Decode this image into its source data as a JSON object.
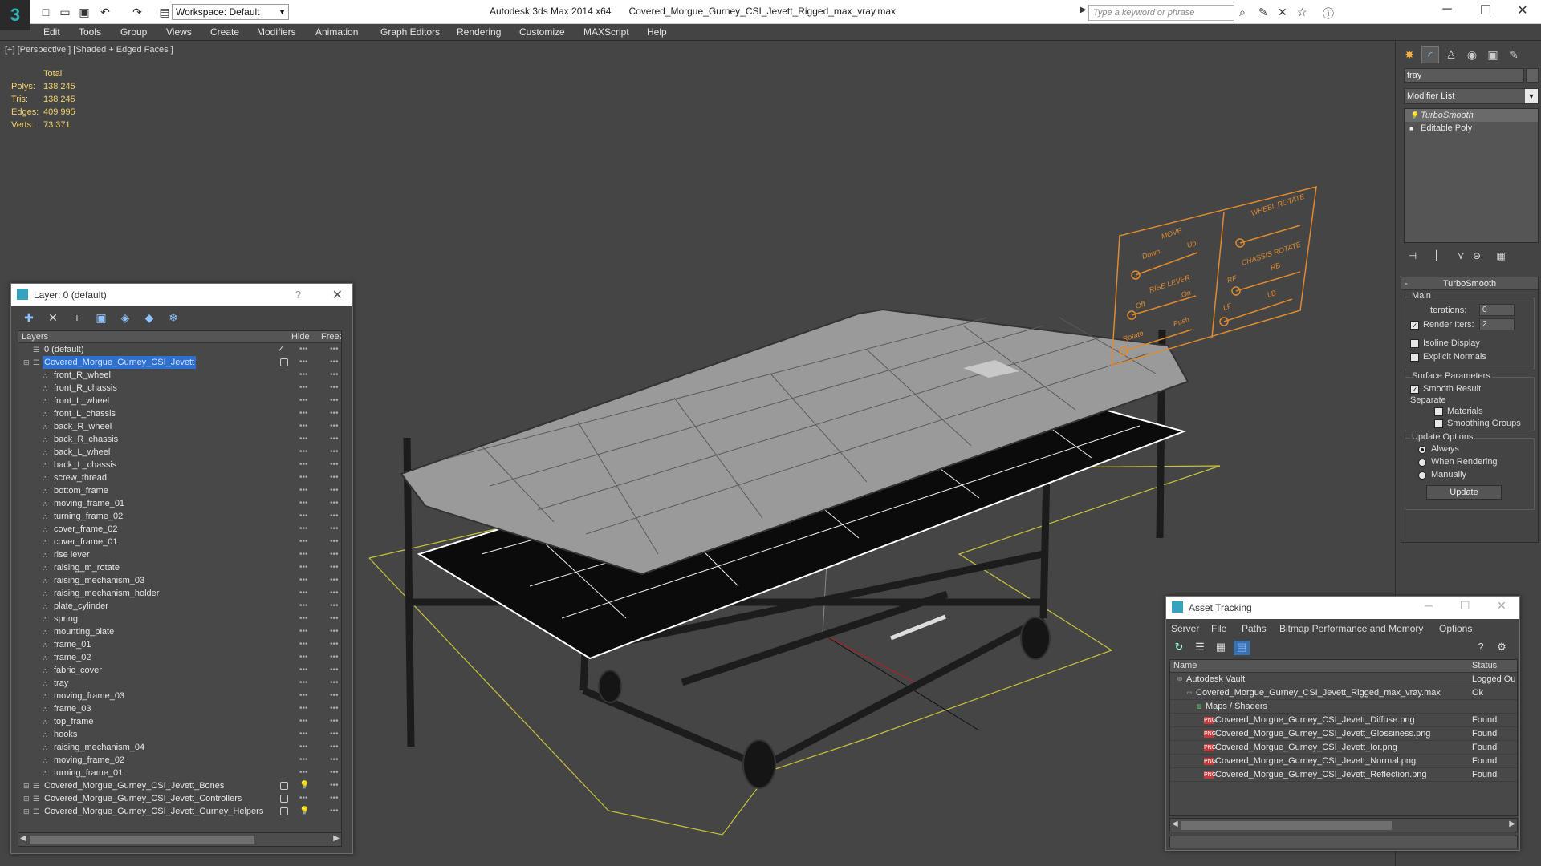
{
  "titlebar": {
    "workspace": "Workspace: Default",
    "app_name": "Autodesk 3ds Max  2014 x64",
    "file_name": "Covered_Morgue_Gurney_CSI_Jevett_Rigged_max_vray.max",
    "search_placeholder": "Type a keyword or phrase"
  },
  "menu": [
    "Edit",
    "Tools",
    "Group",
    "Views",
    "Create",
    "Modifiers",
    "Animation",
    "Graph Editors",
    "Rendering",
    "Customize",
    "MAXScript",
    "Help"
  ],
  "viewport": {
    "label": "[+] [Perspective ] [Shaded + Edged Faces ]",
    "stats": {
      "header": "Total",
      "rows": [
        {
          "label": "Polys:",
          "value": "138 245"
        },
        {
          "label": "Tris:",
          "value": "138 245"
        },
        {
          "label": "Edges:",
          "value": "409 995"
        },
        {
          "label": "Verts:",
          "value": "73 371"
        }
      ]
    },
    "panel_labels": {
      "move": "MOVE",
      "down": "Down",
      "up": "Up",
      "rise_lever": "RISE LEVER",
      "off": "Off",
      "on": "On",
      "rotate": "Rotate",
      "push": "Push",
      "wheel_rotate": "WHEEL ROTATE",
      "chassis_rotate": "CHASSIS ROTATE",
      "rf": "RF",
      "rb": "RB",
      "lf": "LF",
      "lb": "LB"
    }
  },
  "command_panel": {
    "object_name": "tray",
    "modifier_list": "Modifier List",
    "stack": [
      "TurboSmooth",
      "Editable Poly"
    ],
    "rollout": {
      "title": "TurboSmooth",
      "main_label": "Main",
      "iterations_label": "Iterations:",
      "iterations_value": "0",
      "render_iters_label": "Render Iters:",
      "render_iters_value": "2",
      "isoline": "Isoline Display",
      "explicit": "Explicit Normals",
      "surface_label": "Surface Parameters",
      "smooth_result": "Smooth Result",
      "separate": "Separate",
      "materials": "Materials",
      "smoothing_groups": "Smoothing Groups",
      "update_options": "Update Options",
      "always": "Always",
      "when_rendering": "When Rendering",
      "manually": "Manually",
      "update_button": "Update"
    }
  },
  "layer_window": {
    "title": "Layer: 0 (default)",
    "help": "?",
    "col_layers": "Layers",
    "col_hide": "Hide",
    "col_freeze": "Freez",
    "rows": [
      {
        "name": "0 (default)",
        "level": 0
      },
      {
        "name": "Covered_Morgue_Gurney_CSI_Jevett",
        "level": 0
      },
      {
        "name": "front_R_wheel",
        "level": 1
      },
      {
        "name": "front_R_chassis",
        "level": 1
      },
      {
        "name": "front_L_wheel",
        "level": 1
      },
      {
        "name": "front_L_chassis",
        "level": 1
      },
      {
        "name": "back_R_wheel",
        "level": 1
      },
      {
        "name": "back_R_chassis",
        "level": 1
      },
      {
        "name": "back_L_wheel",
        "level": 1
      },
      {
        "name": "back_L_chassis",
        "level": 1
      },
      {
        "name": "screw_thread",
        "level": 1
      },
      {
        "name": "bottom_frame",
        "level": 1
      },
      {
        "name": "moving_frame_01",
        "level": 1
      },
      {
        "name": "turning_frame_02",
        "level": 1
      },
      {
        "name": "cover_frame_02",
        "level": 1
      },
      {
        "name": "cover_frame_01",
        "level": 1
      },
      {
        "name": "rise lever",
        "level": 1
      },
      {
        "name": "raising_m_rotate",
        "level": 1
      },
      {
        "name": "raising_mechanism_03",
        "level": 1
      },
      {
        "name": "raising_mechanism_holder",
        "level": 1
      },
      {
        "name": "plate_cylinder",
        "level": 1
      },
      {
        "name": "spring",
        "level": 1
      },
      {
        "name": "mounting_plate",
        "level": 1
      },
      {
        "name": "frame_01",
        "level": 1
      },
      {
        "name": "frame_02",
        "level": 1
      },
      {
        "name": "fabric_cover",
        "level": 1
      },
      {
        "name": "tray",
        "level": 1
      },
      {
        "name": "moving_frame_03",
        "level": 1
      },
      {
        "name": "frame_03",
        "level": 1
      },
      {
        "name": "top_frame",
        "level": 1
      },
      {
        "name": "hooks",
        "level": 1
      },
      {
        "name": "raising_mechanism_04",
        "level": 1
      },
      {
        "name": "moving_frame_02",
        "level": 1
      },
      {
        "name": "turning_frame_01",
        "level": 1
      },
      {
        "name": "Covered_Morgue_Gurney_CSI_Jevett_Bones",
        "level": 0
      },
      {
        "name": "Covered_Morgue_Gurney_CSI_Jevett_Controllers",
        "level": 0
      },
      {
        "name": "Covered_Morgue_Gurney_CSI_Jevett_Gurney_Helpers",
        "level": 0
      }
    ]
  },
  "asset_window": {
    "title": "Asset Tracking",
    "menu": [
      "Server",
      "File",
      "Paths",
      "Bitmap Performance and Memory",
      "Options"
    ],
    "col_name": "Name",
    "col_status": "Status",
    "rows": [
      {
        "name": "Autodesk Vault",
        "status": "Logged Ou",
        "indent": 0
      },
      {
        "name": "Covered_Morgue_Gurney_CSI_Jevett_Rigged_max_vray.max",
        "status": "Ok",
        "indent": 1
      },
      {
        "name": "Maps / Shaders",
        "status": "",
        "indent": 2
      },
      {
        "name": "Covered_Morgue_Gurney_CSI_Jevett_Diffuse.png",
        "status": "Found",
        "indent": 3
      },
      {
        "name": "Covered_Morgue_Gurney_CSI_Jevett_Glossiness.png",
        "status": "Found",
        "indent": 3
      },
      {
        "name": "Covered_Morgue_Gurney_CSI_Jevett_Ior.png",
        "status": "Found",
        "indent": 3
      },
      {
        "name": "Covered_Morgue_Gurney_CSI_Jevett_Normal.png",
        "status": "Found",
        "indent": 3
      },
      {
        "name": "Covered_Morgue_Gurney_CSI_Jevett_Reflection.png",
        "status": "Found",
        "indent": 3
      }
    ]
  },
  "colors": {
    "accent": "#2e6fd0",
    "stats": "#f4d36a",
    "grid": "#c9c23a",
    "panel_orange": "#e08a2c"
  }
}
